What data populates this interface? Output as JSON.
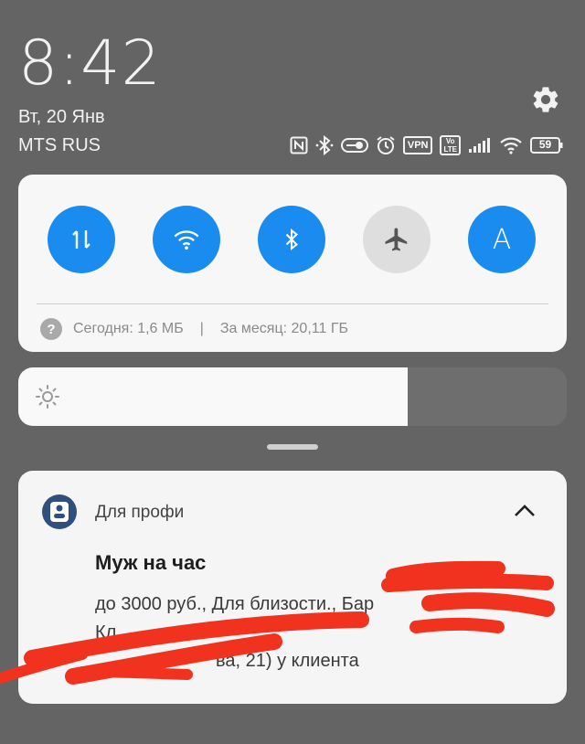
{
  "status_bar": {
    "time": "8:42",
    "date": "Вт, 20 Янв",
    "carrier": "MTS RUS",
    "icons": [
      "nfc-icon",
      "bluetooth-icon",
      "key-icon",
      "alarm-icon",
      "vpn-icon",
      "volte-icon",
      "signal-icon",
      "wifi-icon",
      "battery-icon"
    ],
    "vpn_label": "VPN",
    "volte_top": "Vo",
    "volte_bottom": "LTE",
    "battery": "59"
  },
  "quick_settings": {
    "toggles": [
      {
        "name": "mobile-data-toggle",
        "icon": "data-arrows-icon",
        "state": "on"
      },
      {
        "name": "wifi-toggle",
        "icon": "wifi-icon",
        "state": "on"
      },
      {
        "name": "bluetooth-toggle",
        "icon": "bluetooth-icon",
        "state": "on"
      },
      {
        "name": "airplane-mode-toggle",
        "icon": "airplane-icon",
        "state": "off"
      },
      {
        "name": "auto-brightness-toggle",
        "icon": "letter-a-icon",
        "state": "on",
        "label": "A"
      }
    ],
    "usage": {
      "today": "Сегодня: 1,6 МБ",
      "separator": "|",
      "month": "За месяц: 20,11 ГБ",
      "help_symbol": "?"
    },
    "colors": {
      "accent": "#1a8cf0",
      "off": "#dedede"
    }
  },
  "brightness": {
    "level": 0.71
  },
  "notification": {
    "app_name": "Для профи",
    "title": "Муж на час",
    "body_line1": "до 3000 руб., Для близости., Бар",
    "body_line2": "Кл",
    "body_line3": "ва, 21) у клиента",
    "redaction_color": "#f0321e"
  }
}
